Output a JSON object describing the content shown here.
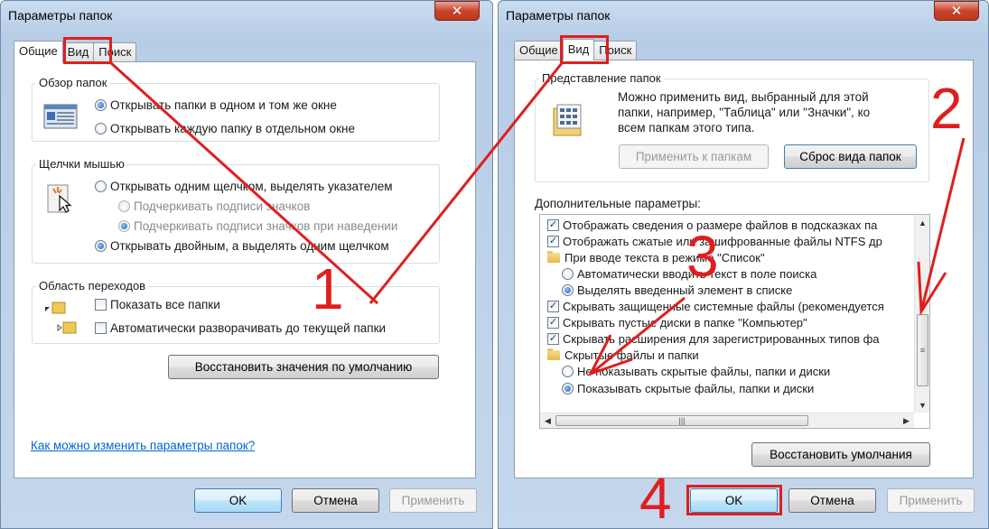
{
  "left_window": {
    "title": "Параметры папок",
    "close_glyph": "✕",
    "tabs": [
      {
        "label": "Общие",
        "active": true
      },
      {
        "label": "Вид",
        "active": false
      },
      {
        "label": "Поиск",
        "active": false
      }
    ],
    "browse_group": {
      "title": "Обзор папок",
      "options": [
        {
          "label": "Открывать папки в одном и том же окне",
          "checked": true
        },
        {
          "label": "Открывать каждую папку в отдельном окне",
          "checked": false
        }
      ]
    },
    "click_group": {
      "title": "Щелчки мышью",
      "options": [
        {
          "label": "Открывать одним щелчком, выделять указателем",
          "checked": false
        },
        {
          "label": "Подчеркивать подписи значков",
          "checked": false,
          "disabled": true
        },
        {
          "label": "Подчеркивать подписи значков при наведении",
          "checked": true,
          "disabled": true
        },
        {
          "label": "Открывать двойным, а выделять одним щелчком",
          "checked": true
        }
      ]
    },
    "nav_group": {
      "title": "Область переходов",
      "options": [
        {
          "label": "Показать все папки",
          "checked": false
        },
        {
          "label": "Автоматически разворачивать до текущей папки",
          "checked": false
        }
      ]
    },
    "restore_button": "Восстановить значения по умолчанию",
    "help_link": "Как можно изменить параметры папок?",
    "ok": "OK",
    "cancel": "Отмена",
    "apply": "Применить"
  },
  "right_window": {
    "title": "Параметры папок",
    "close_glyph": "✕",
    "tabs": [
      {
        "label": "Общие",
        "active": false
      },
      {
        "label": "Вид",
        "active": true
      },
      {
        "label": "Поиск",
        "active": false
      }
    ],
    "folder_view_group": {
      "title": "Представление папок",
      "description": "Можно применить вид, выбранный для этой папки, например, \"Таблица\" или \"Значки\", ко всем папкам этого типа.",
      "apply_button": "Применить к папкам",
      "reset_button": "Сброс вида папок"
    },
    "advanced_label": "Дополнительные параметры:",
    "advanced_items": [
      {
        "kind": "check",
        "checked": true,
        "indent": 0,
        "label": "Отображать сведения о размере файлов в подсказках па"
      },
      {
        "kind": "check",
        "checked": true,
        "indent": 0,
        "label": "Отображать сжатые или зашифрованные файлы NTFS др"
      },
      {
        "kind": "folder",
        "indent": 0,
        "label": "При вводе текста в режиме \"Список\""
      },
      {
        "kind": "radio",
        "checked": false,
        "indent": 1,
        "label": "Автоматически вводить текст в поле поиска"
      },
      {
        "kind": "radio",
        "checked": true,
        "indent": 1,
        "label": "Выделять введенный элемент в списке"
      },
      {
        "kind": "check",
        "checked": true,
        "indent": 0,
        "label": "Скрывать защищенные системные файлы (рекомендуется"
      },
      {
        "kind": "check",
        "checked": true,
        "indent": 0,
        "label": "Скрывать пустые диски в папке \"Компьютер\""
      },
      {
        "kind": "check",
        "checked": true,
        "indent": 0,
        "label": "Скрывать расширения для зарегистрированных типов фа"
      },
      {
        "kind": "folder",
        "indent": 0,
        "label": "Скрытые файлы и папки"
      },
      {
        "kind": "radio",
        "checked": false,
        "indent": 1,
        "label": "Не показывать скрытые файлы, папки и диски"
      },
      {
        "kind": "radio",
        "checked": true,
        "indent": 1,
        "label": "Показывать скрытые файлы, папки и диски"
      }
    ],
    "restore_button": "Восстановить умолчания",
    "ok": "OK",
    "cancel": "Отмена",
    "apply": "Применить"
  },
  "annotations": {
    "step1": "1",
    "step2": "2",
    "step3": "3",
    "step4": "4",
    "color": "#e01e1e"
  },
  "glyphs": {
    "check": "✓",
    "arrow_up": "▲",
    "arrow_down": "▼",
    "arrow_left": "◀",
    "arrow_right": "▶",
    "grip": "≡",
    "grip_h": "|||",
    "tree_expanded": "◢",
    "tree_collapsed": "▷"
  }
}
